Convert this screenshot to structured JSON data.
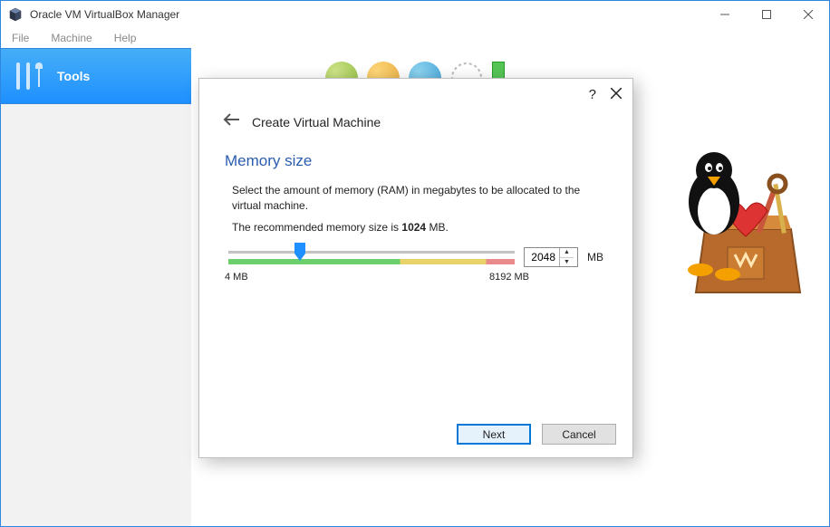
{
  "window": {
    "title": "Oracle VM VirtualBox Manager"
  },
  "menu": {
    "file": "File",
    "machine": "Machine",
    "help": "Help"
  },
  "sidebar": {
    "tools_label": "Tools"
  },
  "dialog": {
    "header": "Create Virtual Machine",
    "title": "Memory size",
    "desc": "Select the amount of memory (RAM) in megabytes to be allocated to the virtual machine.",
    "recommend_prefix": "The recommended memory size is ",
    "recommend_value": "1024",
    "recommend_suffix": " MB.",
    "min_label": "4 MB",
    "max_label": "8192 MB",
    "value": "2048",
    "unit": "MB",
    "next": "Next",
    "cancel": "Cancel"
  }
}
